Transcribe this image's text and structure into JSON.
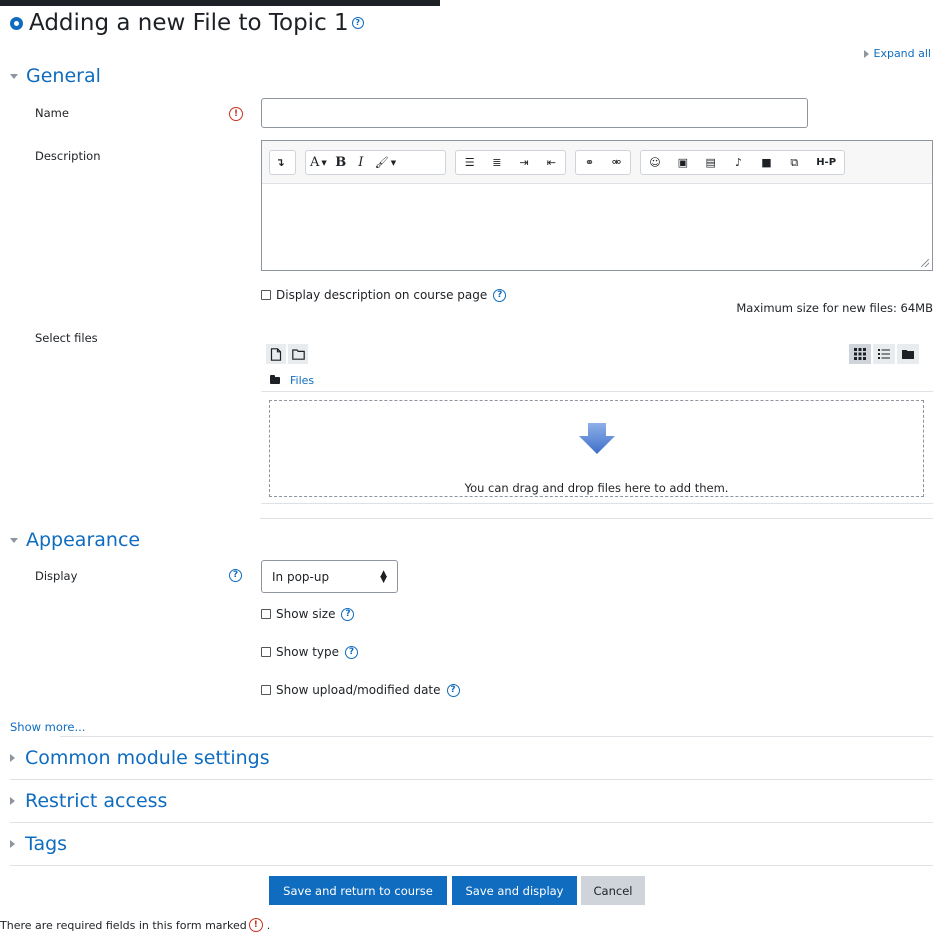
{
  "page": {
    "title": "Adding a new File to Topic 1",
    "expand_all": "Expand all"
  },
  "sections": {
    "general": "General",
    "appearance": "Appearance",
    "common_module": "Common module settings",
    "restrict_access": "Restrict access",
    "tags": "Tags"
  },
  "general": {
    "name_label": "Name",
    "name_value": "",
    "description_label": "Description",
    "description_value": "",
    "display_description_label": "Display description on course page",
    "select_files_label": "Select files",
    "max_size": "Maximum size for new files: 64MB",
    "files_path": "Files",
    "drop_text": "You can drag and drop files here to add them."
  },
  "editor_toolbar": {
    "buttons": [
      "toggle-toolbar",
      "font-size",
      "bold",
      "italic",
      "text-color",
      "unordered-list",
      "ordered-list",
      "indent",
      "outdent",
      "link",
      "unlink",
      "emoji",
      "image",
      "media",
      "record-audio",
      "record-video",
      "manage-files",
      "h5p"
    ],
    "font_label": "A",
    "bold_label": "B",
    "italic_label": "I",
    "h5p_label": "H-P"
  },
  "appearance": {
    "display_label": "Display",
    "display_value": "In pop-up",
    "show_size": "Show size",
    "show_type": "Show type",
    "show_date": "Show upload/modified date",
    "show_more": "Show more..."
  },
  "buttons": {
    "save_return": "Save and return to course",
    "save_display": "Save and display",
    "cancel": "Cancel"
  },
  "footer": {
    "required_note": "There are required fields in this form marked",
    "required_note_end": "."
  },
  "colors": {
    "primary": "#0f6cbf",
    "required": "#ca3120"
  }
}
